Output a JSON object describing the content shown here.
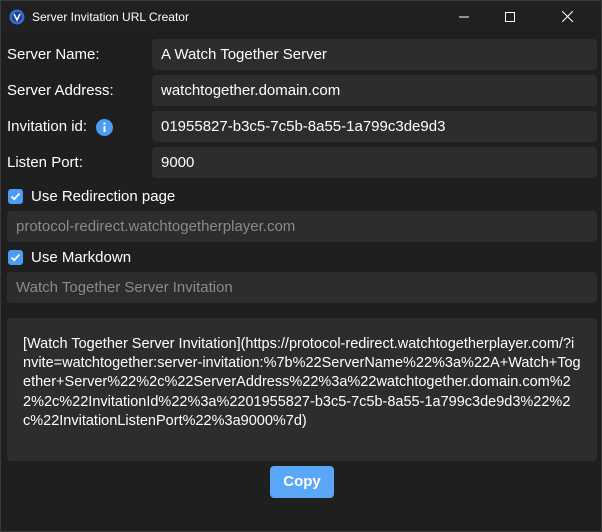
{
  "window": {
    "title": "Server Invitation URL Creator"
  },
  "form": {
    "server_name": {
      "label": "Server Name:",
      "value": "A Watch Together Server"
    },
    "server_address": {
      "label": "Server Address:",
      "value": "watchtogether.domain.com"
    },
    "invitation_id": {
      "label": "Invitation id:",
      "value": "01955827-b3c5-7c5b-8a55-1a799c3de9d3"
    },
    "listen_port": {
      "label": "Listen Port:",
      "value": "9000"
    },
    "use_redirection": {
      "label": "Use Redirection page",
      "checked": true,
      "value": "protocol-redirect.watchtogetherplayer.com"
    },
    "use_markdown": {
      "label": "Use Markdown",
      "checked": true,
      "value": "Watch Together Server Invitation"
    }
  },
  "output": {
    "text": "[Watch Together Server Invitation](https://protocol-redirect.watchtogetherplayer.com/?invite=watchtogether:server-invitation:%7b%22ServerName%22%3a%22A+Watch+Together+Server%22%2c%22ServerAddress%22%3a%22watchtogether.domain.com%22%2c%22InvitationId%22%3a%2201955827-b3c5-7c5b-8a55-1a799c3de9d3%22%2c%22InvitationListenPort%22%3a9000%7d)"
  },
  "actions": {
    "copy_label": "Copy"
  },
  "colors": {
    "accent": "#4a9cf5",
    "button": "#5aa6f7",
    "background": "#1f1f1f",
    "field": "#2d2d2d"
  },
  "icons": {
    "app": "app-logo-icon",
    "info": "info-icon",
    "minimize": "minimize-icon",
    "maximize": "maximize-icon",
    "close": "close-icon",
    "check": "checkmark-icon"
  }
}
